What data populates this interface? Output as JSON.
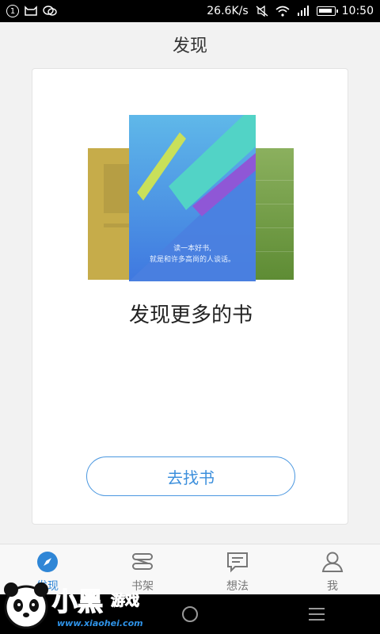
{
  "status_bar": {
    "notification_count": "1",
    "speed": "26.6K/s",
    "time": "10:50",
    "icons": [
      "cat-icon",
      "wechat-icon",
      "mute-icon",
      "wifi-icon",
      "signal-icon",
      "battery-icon"
    ]
  },
  "page": {
    "title": "发现"
  },
  "card": {
    "book_tagline_line1": "读一本好书,",
    "book_tagline_line2": "就是和许多高尚的人谈话。",
    "heading": "发现更多的书",
    "button_label": "去找书"
  },
  "tabs": [
    {
      "label": "发现",
      "icon": "compass-icon",
      "active": true
    },
    {
      "label": "书架",
      "icon": "bookshelf-icon",
      "active": false
    },
    {
      "label": "想法",
      "icon": "comment-icon",
      "active": false
    },
    {
      "label": "我",
      "icon": "person-icon",
      "active": false
    }
  ],
  "watermark": {
    "brand": "小黑",
    "brand_sub": "游戏",
    "url": "www.xiaohei.com"
  },
  "colors": {
    "accent": "#2f86d6",
    "button_border": "#4a97e0",
    "book_left": "#c6ac4a",
    "book_right": "#6f9c44",
    "book_main": "#4a86e0"
  }
}
